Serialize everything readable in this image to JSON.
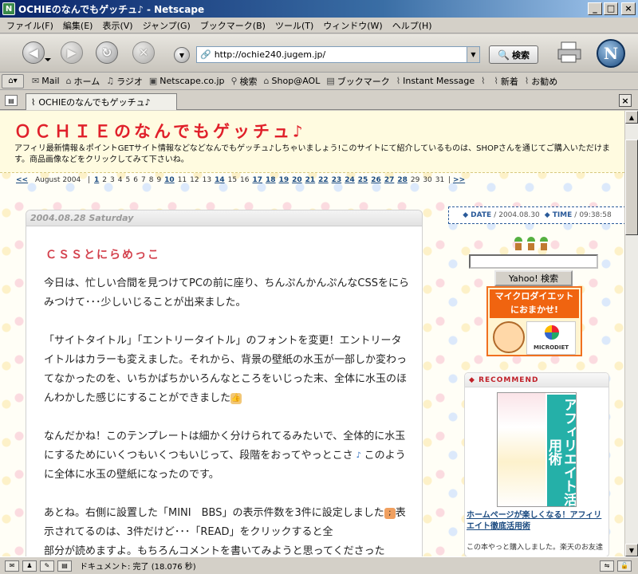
{
  "window": {
    "title": "OCHIEのなんでもゲッチュ♪ - Netscape",
    "minimize": "_",
    "maximize": "□",
    "close": "×"
  },
  "menu": [
    "ファイル(F)",
    "編集(E)",
    "表示(V)",
    "ジャンプ(G)",
    "ブックマーク(B)",
    "ツール(T)",
    "ウィンドウ(W)",
    "ヘルプ(H)"
  ],
  "nav": {
    "url": "http://ochie240.jugem.jp/",
    "search_label": "検索",
    "logo_letter": "N"
  },
  "bookmarks": [
    "Mail",
    "ホーム",
    "ラジオ",
    "Netscape.co.jp",
    "検索",
    "Shop@AOL",
    "ブックマーク",
    "Instant Message",
    "新着",
    "お勧め"
  ],
  "tab": {
    "label": "OCHIEのなんでもゲッチュ♪"
  },
  "page": {
    "site_title": "ＯＣＨＩＥのなんでもゲッチュ♪",
    "site_desc": "アフィリ最新情報＆ポイントGETサイト情報などなどなんでもゲッチュ♪しちゃいましょう!このサイトにて紹介しているものは、SHOPさんを通じてご購入いただけます。商品画像などをクリックしてみて下さいね。",
    "calendar": {
      "prev": "<<",
      "month": "August 2004",
      "next": ">>",
      "days": [
        {
          "d": "1",
          "link": true
        },
        {
          "d": "2",
          "link": false
        },
        {
          "d": "3",
          "link": false
        },
        {
          "d": "4",
          "link": false
        },
        {
          "d": "5",
          "link": false
        },
        {
          "d": "6",
          "link": false
        },
        {
          "d": "7",
          "link": false
        },
        {
          "d": "8",
          "link": false
        },
        {
          "d": "9",
          "link": false
        },
        {
          "d": "10",
          "link": true
        },
        {
          "d": "11",
          "link": false
        },
        {
          "d": "12",
          "link": false
        },
        {
          "d": "13",
          "link": false
        },
        {
          "d": "14",
          "link": true
        },
        {
          "d": "15",
          "link": false
        },
        {
          "d": "16",
          "link": false
        },
        {
          "d": "17",
          "link": true
        },
        {
          "d": "18",
          "link": true
        },
        {
          "d": "19",
          "link": true
        },
        {
          "d": "20",
          "link": true
        },
        {
          "d": "21",
          "link": true
        },
        {
          "d": "22",
          "link": true
        },
        {
          "d": "23",
          "link": true
        },
        {
          "d": "24",
          "link": true
        },
        {
          "d": "25",
          "link": true
        },
        {
          "d": "26",
          "link": true
        },
        {
          "d": "27",
          "link": true
        },
        {
          "d": "28",
          "link": true
        },
        {
          "d": "29",
          "link": false
        },
        {
          "d": "30",
          "link": false
        },
        {
          "d": "31",
          "link": false
        }
      ]
    },
    "post": {
      "date": "2004.08.28 Saturday",
      "title": "ＣＳＳとにらめっこ",
      "paragraphs": [
        "今日は、忙しい合間を見つけてPCの前に座り、ちんぷんかんぷんなCSSをにらみつけて･･･少しいじることが出来ました。",
        "「サイトタイトル」「エントリータイトル」のフォントを変更！エントリータイトルはカラーも変えました。それから、背景の壁紙の水玉が一部しか変わってなかったのを、いちかばちかいろんなところをいじった末、全体に水玉のほんわかした感じにすることができました",
        "なんだかね！このテンプレートは細かく分けられてるみたいで、全体的に水玉にするためにいくつもいくつもいじって、段階をおってやっとこさ",
        "あとね。右側に設置した「MINI　BBS」の表示件数を3件に設定しました",
        "部分が読めますよ。もちろんコメントを書いてみようと思ってくださった"
      ],
      "para3_tail": "このように全体に水玉の壁紙になったのです。",
      "para4_tail": "表示されてるのは、3件だけど･･･「READ」をクリックすると全"
    },
    "sidebar": {
      "date_label": "DATE",
      "date_value": "2004.08.30",
      "time_label": "TIME",
      "time_value": "09:38:58",
      "yahoo_button": "Yahoo! 検索",
      "ad_line1": "マイクロダイエット",
      "ad_line2": "におまかせ!",
      "ad_brand": "MICRODIET",
      "recommend_head": "RECOMMEND",
      "book_title": "アフィリエイト活用術",
      "rec_link": "ホームページが楽しくなる！アフィリエイト徹底活用術",
      "rec_desc": "この本やっと購入しました。楽天のお友達"
    }
  },
  "status": {
    "message": "ドキュメント: 完了 (18.076 秒)"
  }
}
